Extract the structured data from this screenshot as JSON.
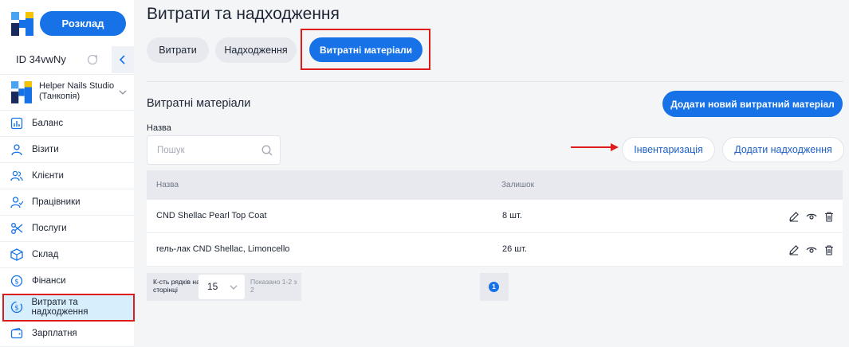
{
  "sidebar": {
    "schedule_label": "Розклад",
    "id_text": "ID 34vwNy",
    "studio_name": "Helper Nails Studio (Танкопія)",
    "items": [
      {
        "label": "Баланс",
        "icon": "chart-icon"
      },
      {
        "label": "Візити",
        "icon": "user-icon"
      },
      {
        "label": "Клієнти",
        "icon": "users-icon"
      },
      {
        "label": "Працівники",
        "icon": "worker-icon"
      },
      {
        "label": "Послуги",
        "icon": "scissors-icon"
      },
      {
        "label": "Склад",
        "icon": "box-icon"
      },
      {
        "label": "Фінанси",
        "icon": "dollar-icon"
      },
      {
        "label": "Витрати та надходження",
        "icon": "money-cycle-icon",
        "active": true
      },
      {
        "label": "Зарплатня",
        "icon": "wallet-icon"
      }
    ]
  },
  "main": {
    "title": "Витрати та надходження",
    "tabs": [
      {
        "label": "Витрати"
      },
      {
        "label": "Надходження"
      },
      {
        "label": "Витратні матеріали",
        "active": true
      }
    ],
    "section_title": "Витратні матеріали",
    "add_material_label": "Додати новий витратний матеріал",
    "search": {
      "label": "Назва",
      "placeholder": "Пошук",
      "value": ""
    },
    "inventory_label": "Інвентаризація",
    "add_income_label": "Додати надходження",
    "table": {
      "headers": {
        "name": "Назва",
        "rest": "Залишок"
      },
      "rows": [
        {
          "name": "CND Shellac Pearl Top Coat",
          "rest": "8 шт."
        },
        {
          "name": "гель-лак CND Shellac, Limoncello",
          "rest": "26 шт."
        }
      ]
    },
    "pagination": {
      "rows_label": "К-сть рядків на сторінці",
      "rows_value": "15",
      "shown_label": "Показано 1-2 з 2",
      "current_page": "1"
    }
  },
  "colors": {
    "accent": "#1672e6",
    "highlight": "#e01b1b",
    "active_nav_bg": "#d7eefc"
  }
}
